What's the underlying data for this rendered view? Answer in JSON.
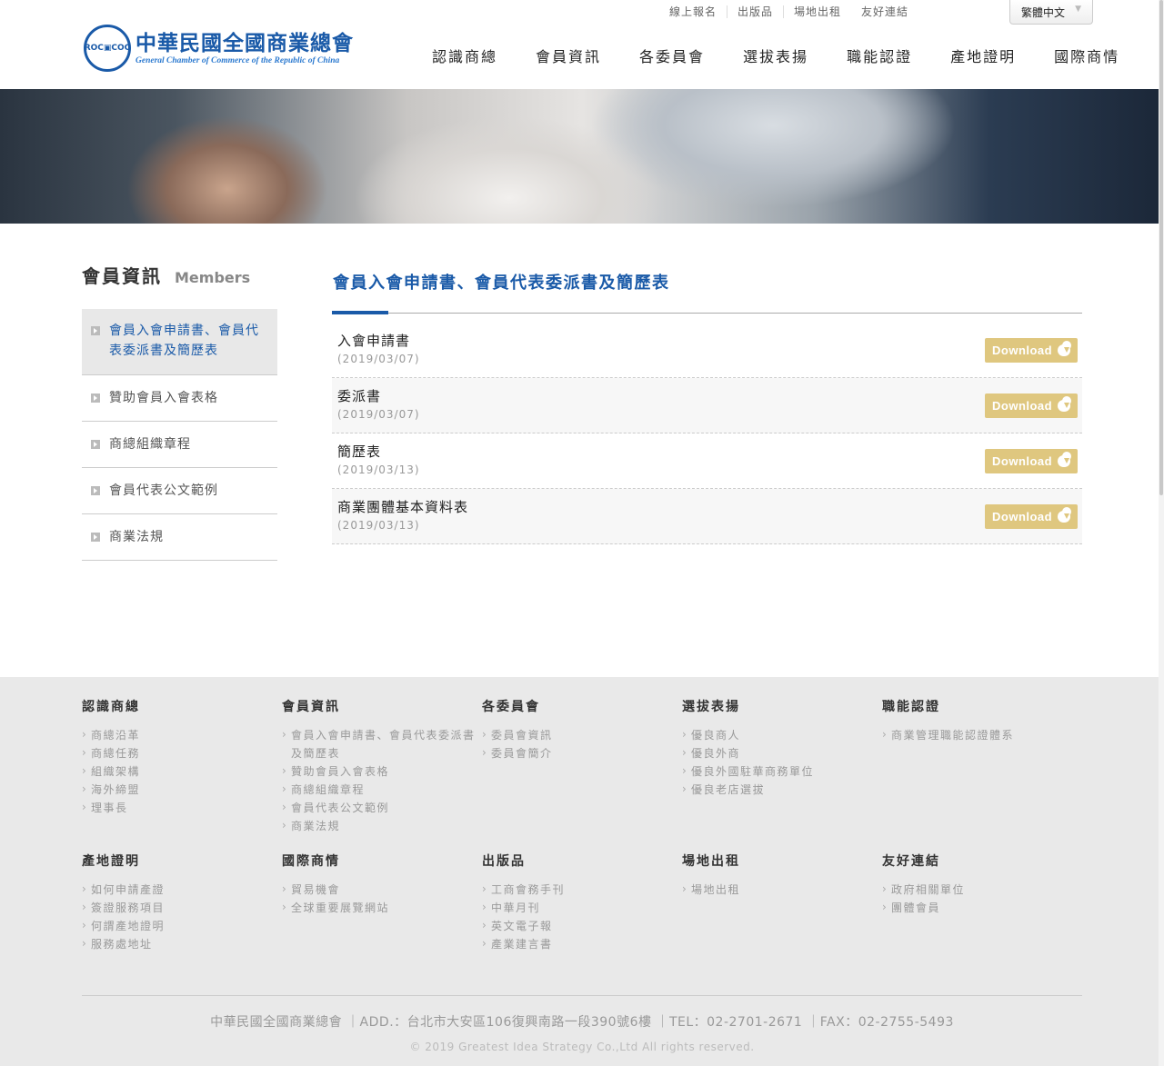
{
  "header": {
    "logo_cn": "中華民國全國商業總會",
    "logo_en": "General Chamber of Commerce of the Republic of China",
    "seal_text": "商ROC COC總",
    "top_links": [
      "線上報名",
      "出版品",
      "場地出租",
      "友好連結"
    ],
    "language": "繁體中文",
    "nav": [
      "認識商總",
      "會員資訊",
      "各委員會",
      "選拔表揚",
      "職能認證",
      "產地證明",
      "國際商情"
    ]
  },
  "sidebar": {
    "title": "會員資訊",
    "subtitle": "Members",
    "items": [
      "會員入會申請書、會員代表委派書及簡歷表",
      "贊助會員入會表格",
      "商總組織章程",
      "會員代表公文範例",
      "商業法規"
    ],
    "active": 0
  },
  "main": {
    "title": "會員入會申請書、會員代表委派書及簡歷表",
    "download_label": "Download",
    "files": [
      {
        "name": "入會申請書",
        "date": "(2019/03/07)"
      },
      {
        "name": "委派書",
        "date": "(2019/03/07)"
      },
      {
        "name": "簡歷表",
        "date": "(2019/03/13)"
      },
      {
        "name": "商業團體基本資料表",
        "date": "(2019/03/13)"
      }
    ]
  },
  "footer": {
    "columns": [
      {
        "title": "認識商總",
        "items": [
          "商總沿革",
          "商總任務",
          "組織架構",
          "海外締盟",
          "理事長"
        ]
      },
      {
        "title": "會員資訊",
        "items": [
          "會員入會申請書、會員代表委派書及簡歷表",
          "贊助會員入會表格",
          "商總組織章程",
          "會員代表公文範例",
          "商業法規"
        ]
      },
      {
        "title": "各委員會",
        "items": [
          "委員會資訊",
          "委員會簡介"
        ]
      },
      {
        "title": "選拔表揚",
        "items": [
          "優良商人",
          "優良外商",
          "優良外國駐華商務單位",
          "優良老店選拔"
        ]
      },
      {
        "title": "職能認證",
        "items": [
          "商業管理職能認證體系"
        ]
      },
      {
        "title": "產地證明",
        "items": [
          "如何申請產證",
          "簽證服務項目",
          "何謂產地證明",
          "服務處地址"
        ]
      },
      {
        "title": "國際商情",
        "items": [
          "貿易機會",
          "全球重要展覽網站"
        ]
      },
      {
        "title": "出版品",
        "items": [
          "工商會務手刊",
          "中華月刊",
          "英文電子報",
          "產業建言書"
        ]
      },
      {
        "title": "場地出租",
        "items": [
          "場地出租"
        ]
      },
      {
        "title": "友好連結",
        "items": [
          "政府相關單位",
          "團體會員"
        ]
      }
    ],
    "address": "中華民國全國商業總會 ｜ADD.：台北市大安區106復興南路一段390號6樓 ｜TEL：02-2701-2671 ｜FAX：02-2755-5493",
    "copyright": "© 2019 Greatest Idea Strategy Co.,Ltd All rights reserved."
  },
  "colors": {
    "brand": "#1a5aa8",
    "download": "#dfc77f",
    "footer_bg": "#e9e9e9"
  }
}
